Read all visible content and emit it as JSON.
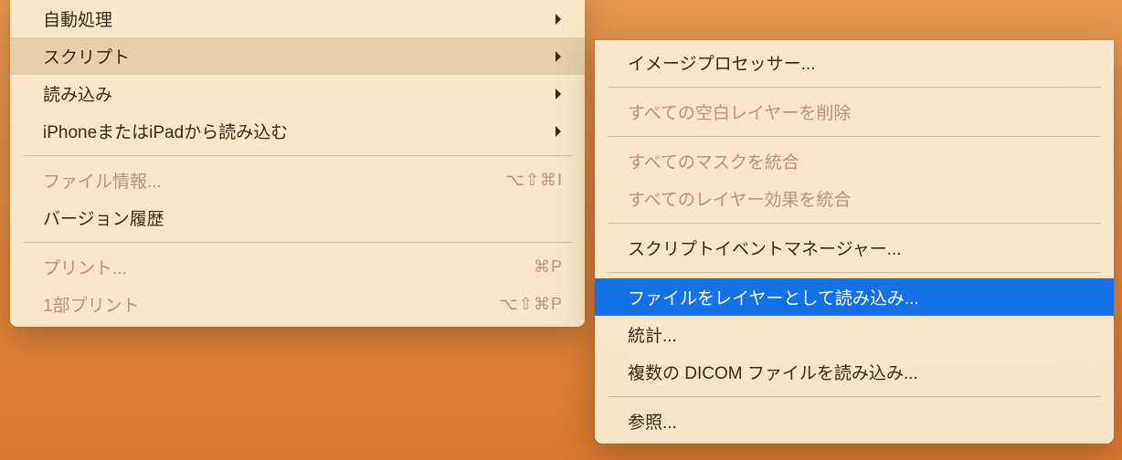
{
  "leftMenu": {
    "items": [
      {
        "label": "自動処理",
        "hasSubmenu": true,
        "state": "normal"
      },
      {
        "label": "スクリプト",
        "hasSubmenu": true,
        "state": "highlighted"
      },
      {
        "label": "読み込み",
        "hasSubmenu": true,
        "state": "normal"
      },
      {
        "label": "iPhoneまたはiPadから読み込む",
        "hasSubmenu": true,
        "state": "normal"
      },
      {
        "separator": true
      },
      {
        "label": "ファイル情報...",
        "shortcut": "⌥⇧⌘I",
        "state": "disabled"
      },
      {
        "label": "バージョン履歴",
        "state": "normal"
      },
      {
        "separator": true
      },
      {
        "label": "プリント...",
        "shortcut": "⌘P",
        "state": "disabled"
      },
      {
        "label": "1部プリント",
        "shortcut": "⌥⇧⌘P",
        "state": "disabled"
      }
    ]
  },
  "rightMenu": {
    "items": [
      {
        "label": "イメージプロセッサー...",
        "state": "normal"
      },
      {
        "separator": true
      },
      {
        "label": "すべての空白レイヤーを削除",
        "state": "disabled"
      },
      {
        "separator": true
      },
      {
        "label": "すべてのマスクを統合",
        "state": "disabled"
      },
      {
        "label": "すべてのレイヤー効果を統合",
        "state": "disabled"
      },
      {
        "separator": true
      },
      {
        "label": "スクリプトイベントマネージャー...",
        "state": "normal"
      },
      {
        "separator": true
      },
      {
        "label": "ファイルをレイヤーとして読み込み...",
        "state": "selected"
      },
      {
        "label": "統計...",
        "state": "normal"
      },
      {
        "label": "複数の DICOM ファイルを読み込み...",
        "state": "normal"
      },
      {
        "separator": true
      },
      {
        "label": "参照...",
        "state": "normal"
      }
    ]
  }
}
